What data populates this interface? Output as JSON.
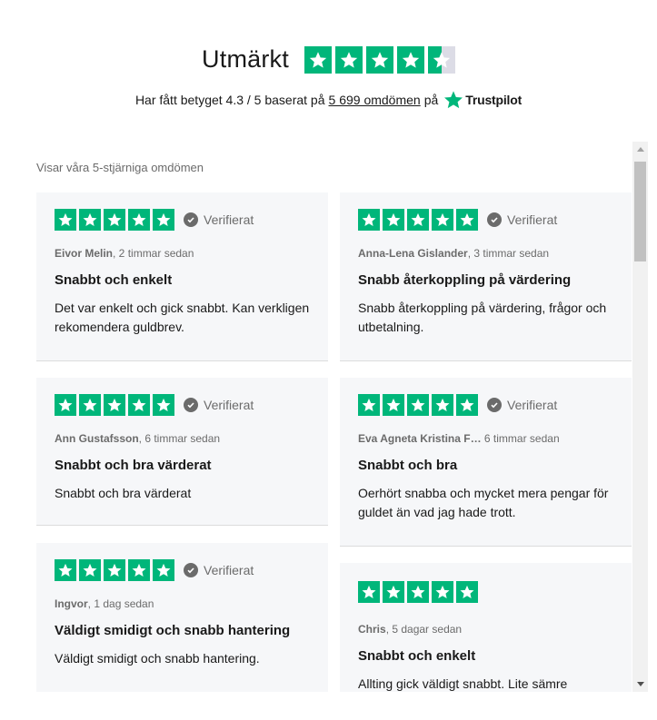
{
  "header": {
    "title": "Utmärkt",
    "rating_prefix": "Har fått betyget 4.3 / 5 baserat på",
    "review_count_link": "5 699 omdömen",
    "rating_suffix": "på",
    "brand": "Trustpilot",
    "stars_value": 4.3
  },
  "colors": {
    "star_green": "#00b67a",
    "star_empty": "#dcdce6",
    "card_bg": "#f6f7f9",
    "muted_text": "#6b6b6b"
  },
  "reviews_section": {
    "label": "Visar våra 5-stjärniga omdömen",
    "verified_label": "Verifierat",
    "reviews": [
      {
        "author": "Eivor Melin",
        "time": ", 2 timmar sedan",
        "title": "Snabbt och enkelt",
        "body": "Det var enkelt och gick snabbt. Kan verkligen rekomendera guldbrev.",
        "stars": 5,
        "verified": true
      },
      {
        "author": "Anna-Lena Gislander",
        "time": ", 3 timmar sedan",
        "title": "Snabb återkoppling på värdering",
        "body": "Snabb återkoppling på värdering, frågor och utbetalning.",
        "stars": 5,
        "verified": true
      },
      {
        "author": "Ann Gustafsson",
        "time": ", 6 timmar sedan",
        "title": "Snabbt och bra värderat",
        "body": "Snabbt och bra värderat",
        "stars": 5,
        "verified": true
      },
      {
        "author": "Eva Agneta Kristina F…",
        "time": " 6 timmar sedan",
        "title": "Snabbt och bra",
        "body": "Oerhört snabba och mycket mera pengar för guldet än vad jag hade trott.",
        "stars": 5,
        "verified": true
      },
      {
        "author": "Ingvor",
        "time": ", 1 dag sedan",
        "title": "Väldigt smidigt och snabb hantering",
        "body": "Väldigt smidigt och snabb hantering.",
        "stars": 5,
        "verified": true
      },
      {
        "author": "Chris",
        "time": ", 5 dagar sedan",
        "title": "Snabbt och enkelt",
        "body": "Allting gick väldigt snabbt. Lite sämre",
        "stars": 5,
        "verified": false
      }
    ]
  }
}
